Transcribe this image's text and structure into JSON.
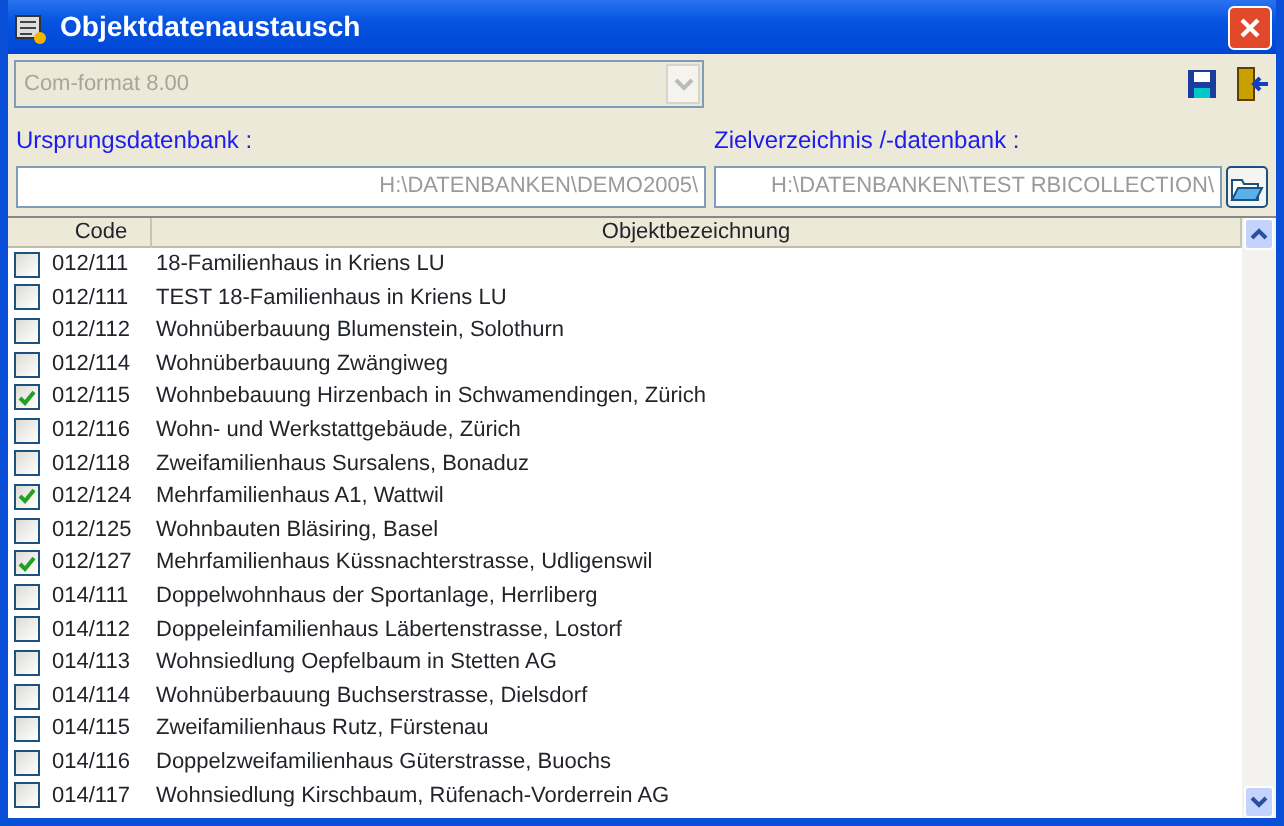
{
  "window": {
    "title": "Objektdatenaustausch"
  },
  "format_select": {
    "value": "Com-format 8.00",
    "disabled": true
  },
  "source": {
    "label": "Ursprungsdatenbank :",
    "value": "H:\\DATENBANKEN\\DEMO2005\\"
  },
  "target": {
    "label": "Zielverzeichnis /-datenbank :",
    "value": "H:\\DATENBANKEN\\TEST  RBICOLLECTION\\"
  },
  "table": {
    "columns": [
      "Code",
      "Objektbezeichnung"
    ],
    "rows": [
      {
        "code": "012/111",
        "name": "18-Familienhaus in Kriens LU",
        "checked": false
      },
      {
        "code": "012/111",
        "name": "TEST 18-Familienhaus in Kriens LU",
        "checked": false
      },
      {
        "code": "012/112",
        "name": "Wohnüberbauung Blumenstein, Solothurn",
        "checked": false
      },
      {
        "code": "012/114",
        "name": "Wohnüberbauung Zwängiweg",
        "checked": false
      },
      {
        "code": "012/115",
        "name": "Wohnbebauung Hirzenbach in Schwamendingen, Zürich",
        "checked": true
      },
      {
        "code": "012/116",
        "name": "Wohn- und Werkstattgebäude, Zürich",
        "checked": false
      },
      {
        "code": "012/118",
        "name": "Zweifamilienhaus Sursalens, Bonaduz",
        "checked": false
      },
      {
        "code": "012/124",
        "name": "Mehrfamilienhaus A1, Wattwil",
        "checked": true
      },
      {
        "code": "012/125",
        "name": "Wohnbauten Bläsiring, Basel",
        "checked": false
      },
      {
        "code": "012/127",
        "name": "Mehrfamilienhaus Küssnachterstrasse, Udligenswil",
        "checked": true
      },
      {
        "code": "014/111",
        "name": "Doppelwohnhaus der Sportanlage, Herrliberg",
        "checked": false
      },
      {
        "code": "014/112",
        "name": "Doppeleinfamilienhaus Läbertenstrasse, Lostorf",
        "checked": false
      },
      {
        "code": "014/113",
        "name": "Wohnsiedlung Oepfelbaum in Stetten AG",
        "checked": false
      },
      {
        "code": "014/114",
        "name": "Wohnüberbauung Buchserstrasse, Dielsdorf",
        "checked": false
      },
      {
        "code": "014/115",
        "name": "Zweifamilienhaus Rutz, Fürstenau",
        "checked": false
      },
      {
        "code": "014/116",
        "name": "Doppelzweifamilienhaus Güterstrasse, Buochs",
        "checked": false
      },
      {
        "code": "014/117",
        "name": "Wohnsiedlung Kirschbaum, Rüfenach-Vorderrein AG",
        "checked": false
      }
    ]
  }
}
